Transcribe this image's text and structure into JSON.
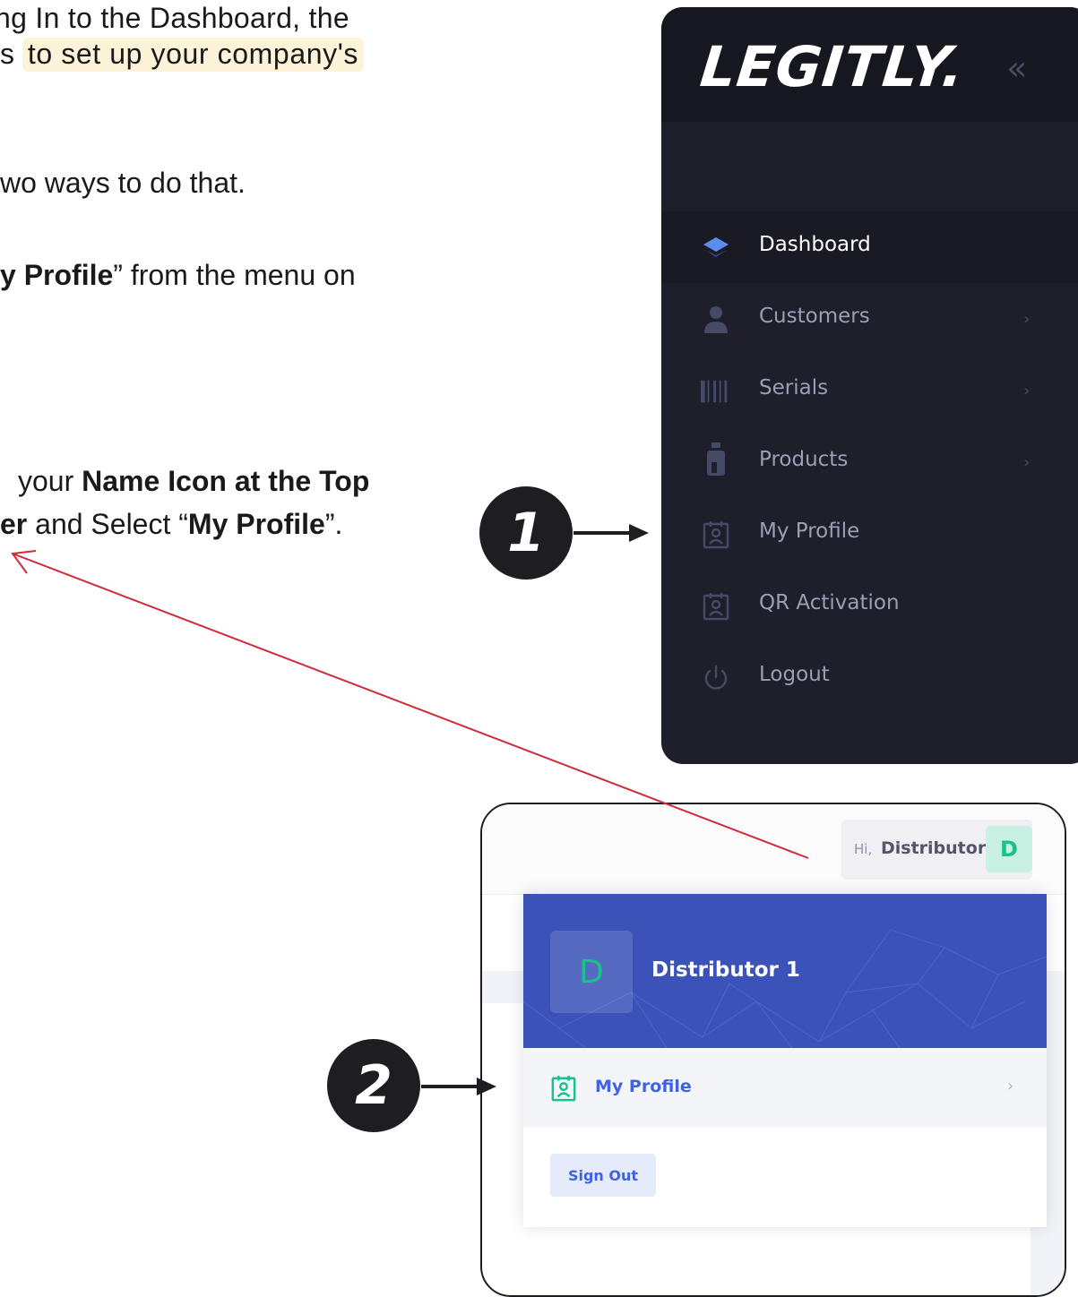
{
  "instructions": {
    "line1": "ng In to the Dashboard, the",
    "line2_pre": "s",
    "line2_highlight": "to set up your company's",
    "line3": "wo ways to do that.",
    "line4_bold": "y Profile",
    "line4_rest": "” from the menu on",
    "line5_pre": "your ",
    "line5_bold": "Name Icon at the Top",
    "line6_bold1": "er",
    "line6_mid": " and Select “",
    "line6_bold2": "My Profile",
    "line6_end": "”."
  },
  "sidebar": {
    "logo": "LEGITLY.",
    "collapse_icon": "double-chevron-left-icon",
    "items": [
      {
        "label": "Dashboard",
        "icon": "layers-icon",
        "active": true
      },
      {
        "label": "Customers",
        "icon": "user-icon",
        "chevron": "›"
      },
      {
        "label": "Serials",
        "icon": "barcode-icon",
        "chevron": "›"
      },
      {
        "label": "Products",
        "icon": "bottle-icon",
        "chevron": "›"
      },
      {
        "label": "My Profile",
        "icon": "id-card-icon"
      },
      {
        "label": "QR Activation",
        "icon": "id-card-icon"
      },
      {
        "label": "Logout",
        "icon": "power-icon"
      }
    ]
  },
  "steps": [
    "1",
    "2"
  ],
  "user_menu": {
    "greeting": "Hi,",
    "user_short": "Distributor",
    "avatar_letter": "D",
    "full_name": "Distributor 1",
    "my_profile": "My Profile",
    "chevron": "›",
    "sign_out": "Sign Out"
  },
  "colors": {
    "sidebar_bg": "#1f1f2b",
    "accent_blue": "#3f63e0",
    "header_blue": "#3b52b8",
    "avatar_green": "#1bc18b",
    "arrow_red": "#d12a3a",
    "highlight": "#fdf3d9"
  }
}
